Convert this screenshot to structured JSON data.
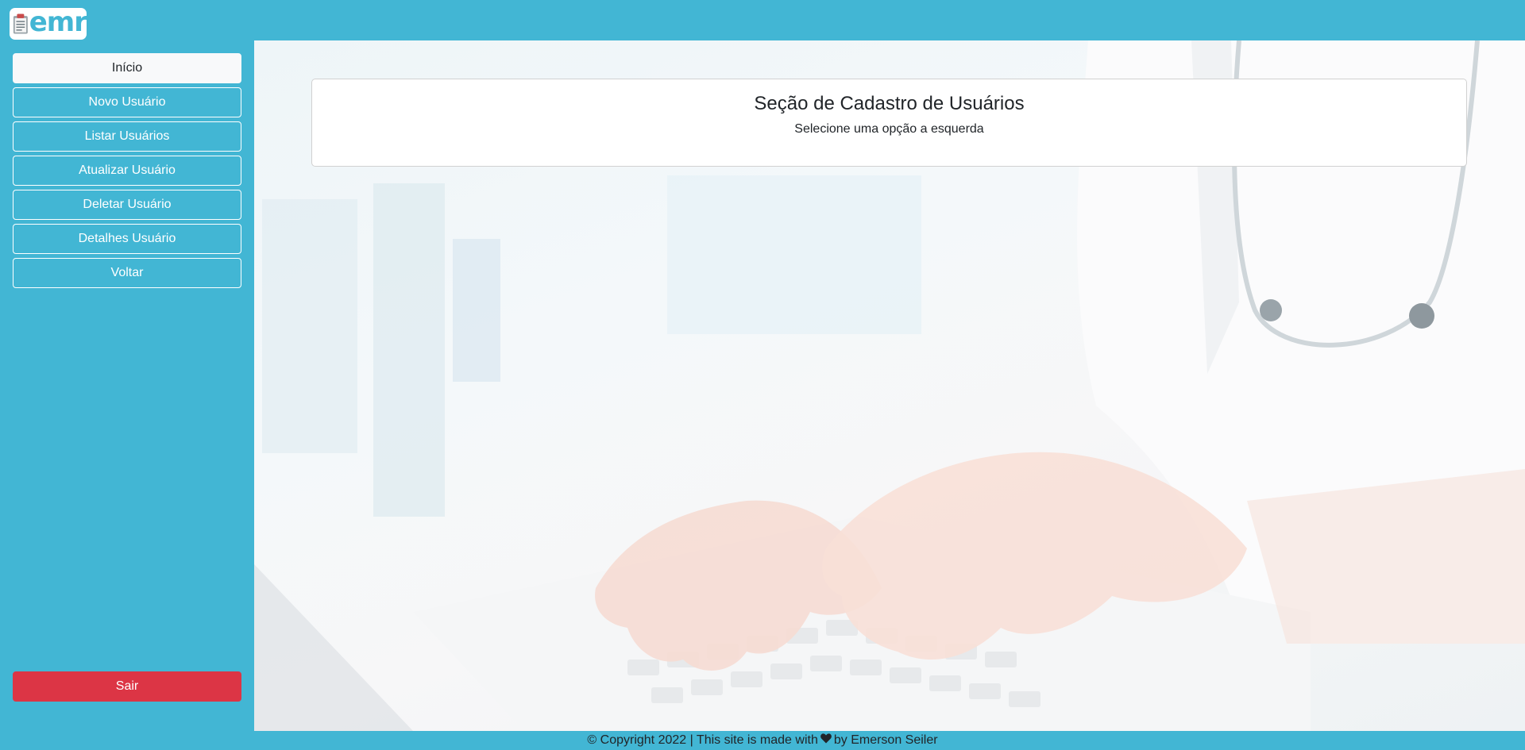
{
  "brand": {
    "logo_text": "emr",
    "logo_icon": "clipboard-icon"
  },
  "sidebar": {
    "items": [
      {
        "label": "Início",
        "active": true
      },
      {
        "label": "Novo Usuário",
        "active": false
      },
      {
        "label": "Listar Usuários",
        "active": false
      },
      {
        "label": "Atualizar Usuário",
        "active": false
      },
      {
        "label": "Deletar Usuário",
        "active": false
      },
      {
        "label": "Detalhes Usuário",
        "active": false
      },
      {
        "label": "Voltar",
        "active": false
      }
    ],
    "logout_label": "Sair"
  },
  "main": {
    "card_title": "Seção de Cadastro de Usuários",
    "card_subtitle": "Selecione uma opção a esquerda"
  },
  "footer": {
    "text_before": "© Copyright 2022 | This site is made with",
    "heart_icon": "heart-icon",
    "text_after": "by Emerson Seiler"
  },
  "colors": {
    "primary": "#42b6d4",
    "danger": "#dc3545",
    "active_button_bg": "#f8f9fa",
    "text_dark": "#212529"
  }
}
